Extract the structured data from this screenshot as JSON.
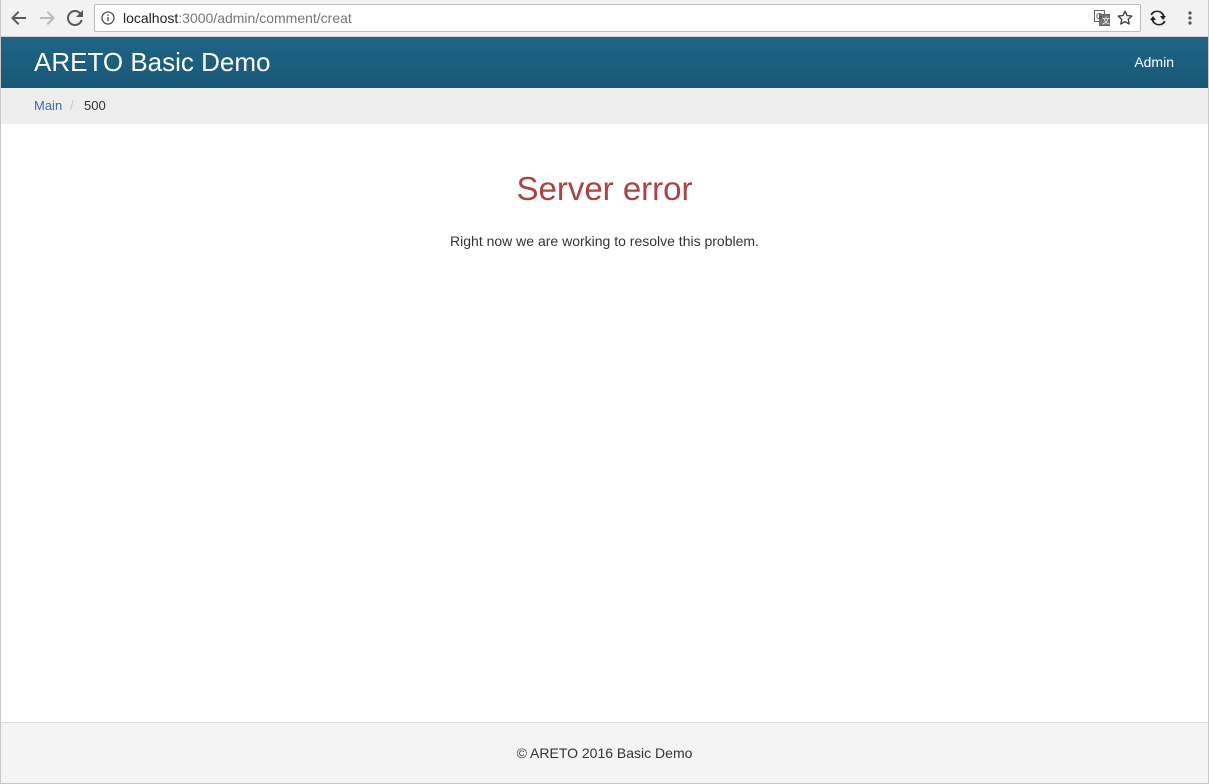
{
  "browser": {
    "url_host": "localhost",
    "url_path": ":3000/admin/comment/creat",
    "icons": {
      "back": "back-arrow-icon",
      "forward": "forward-arrow-icon",
      "reload": "reload-icon",
      "info": "info-icon",
      "translate": "translate-icon",
      "bookmark": "star-icon",
      "extension": "sync-extension-icon",
      "menu": "more-vert-icon"
    }
  },
  "navbar": {
    "brand": "ARETO Basic Demo",
    "admin_link": "Admin",
    "background": "#1b5f80"
  },
  "breadcrumb": {
    "main": "Main",
    "separator": "/",
    "current": "500"
  },
  "content": {
    "title": "Server error",
    "message": "Right now we are working to resolve this problem.",
    "title_color": "#a94442"
  },
  "footer": {
    "text": "© ARETO 2016 Basic Demo"
  }
}
